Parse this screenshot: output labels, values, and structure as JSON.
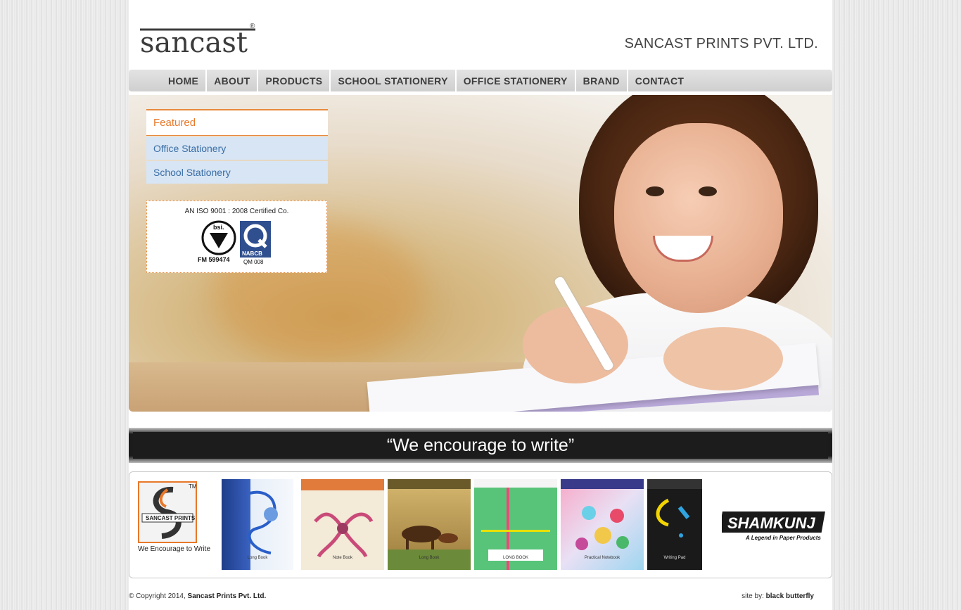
{
  "header": {
    "logo_text": "sancast",
    "logo_mark": "®",
    "company_name": "SANCAST PRINTS PVT. LTD."
  },
  "nav": {
    "items": [
      {
        "label": "HOME"
      },
      {
        "label": "ABOUT"
      },
      {
        "label": "PRODUCTS"
      },
      {
        "label": "SCHOOL STATIONERY"
      },
      {
        "label": "OFFICE STATIONERY"
      },
      {
        "label": "BRAND"
      },
      {
        "label": "CONTACT"
      }
    ]
  },
  "sidebar": {
    "title": "Featured",
    "items": [
      {
        "label": "Office Stationery"
      },
      {
        "label": "School Stationery"
      }
    ]
  },
  "iso": {
    "text": "AN ISO 9001 : 2008 Certified Co.",
    "bsi_label": "bsi.",
    "bsi_number": "FM  599474",
    "nabcb_label": "NABCB",
    "qm_number": "QM 008"
  },
  "tagline": "“We encourage to write”",
  "products": {
    "brand_label": "SANCAST PRINTS",
    "brand_tm": "TM",
    "brand_slogan": "We Encourage to Write",
    "books": [
      {
        "label": "Long Book"
      },
      {
        "label": "Note Book"
      },
      {
        "label": "Long Book"
      },
      {
        "label": "LONG BOOK"
      },
      {
        "label": "Practical Notebook"
      },
      {
        "label": "Writing Pad"
      }
    ],
    "shamkunj_name": "SHAMKUNJ",
    "shamkunj_tagline": "A Legend in Paper Products"
  },
  "footer": {
    "copyright_prefix": "© Copyright 2014,",
    "copyright_company": "Sancast Prints Pvt. Ltd.",
    "site_by_prefix": "site by:",
    "site_by_name": "black butterfly"
  },
  "colors": {
    "accent_orange": "#e8782a",
    "sidebar_blue": "#d7e5f4",
    "sidebar_text": "#3b6ea6"
  }
}
